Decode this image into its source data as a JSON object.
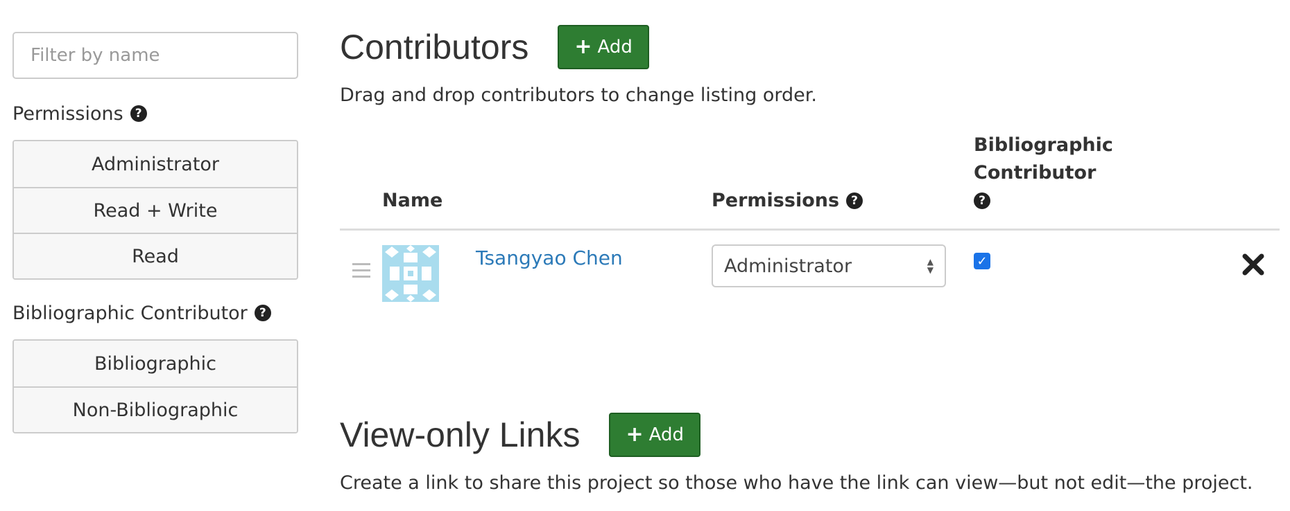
{
  "sidebar": {
    "filter_placeholder": "Filter by name",
    "permissions_label": "Permissions",
    "permission_options": [
      "Administrator",
      "Read + Write",
      "Read"
    ],
    "bibliographic_label": "Bibliographic Contributor",
    "bibliographic_options": [
      "Bibliographic",
      "Non-Bibliographic"
    ]
  },
  "contributors": {
    "title": "Contributors",
    "add_label": "Add",
    "description": "Drag and drop contributors to change listing order.",
    "columns": {
      "name": "Name",
      "permissions": "Permissions",
      "bibliographic_line1": "Bibliographic",
      "bibliographic_line2": "Contributor"
    },
    "rows": [
      {
        "name": "Tsangyao Chen",
        "permission": "Administrator",
        "bibliographic": true
      }
    ]
  },
  "view_only_links": {
    "title": "View-only Links",
    "add_label": "Add",
    "description": "Create a link to share this project so those who have the link can view—but not edit—the project."
  },
  "colors": {
    "add_button": "#2e7d32",
    "link": "#2c7ab8",
    "checkbox": "#1a73e8",
    "avatar": "#a9dcee"
  },
  "icons": {
    "help": "question-circle-icon",
    "remove": "close-icon",
    "drag": "drag-handle-icon",
    "add": "plus-icon"
  }
}
